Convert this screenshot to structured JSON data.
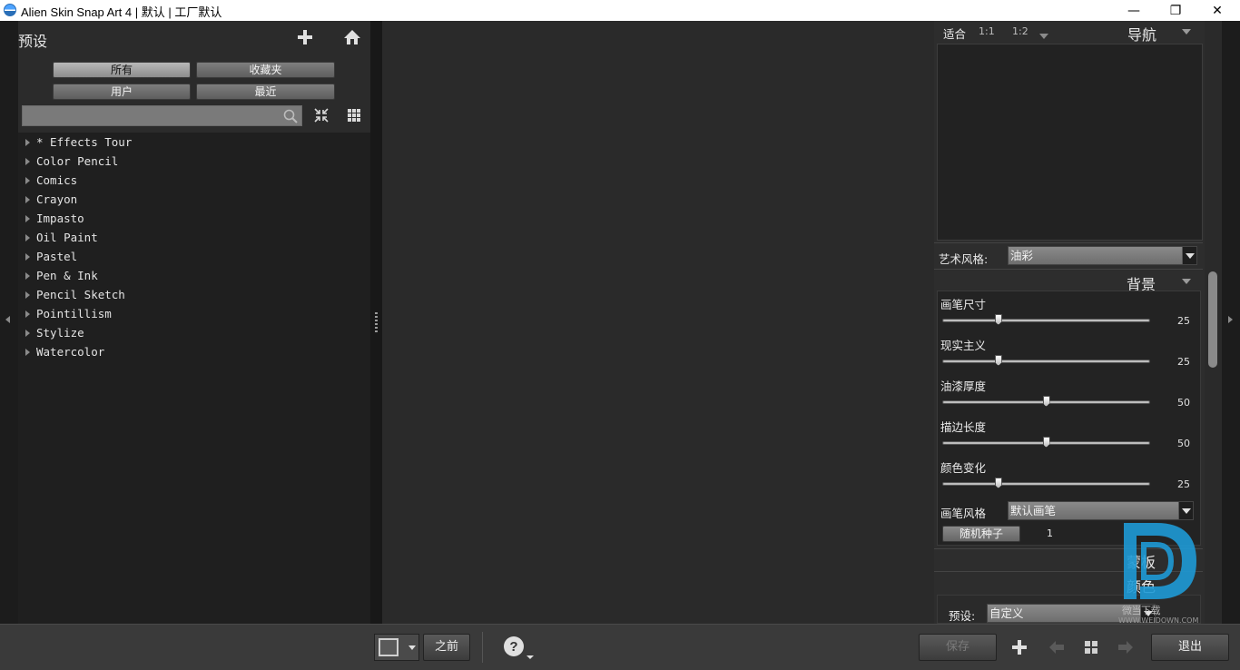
{
  "window": {
    "title": "Alien Skin Snap Art 4 | 默认 | 工厂默认",
    "minimize_glyph": "—",
    "restore_glyph": "❐",
    "close_glyph": "✕"
  },
  "presets": {
    "title": "预设",
    "filters": {
      "all": "所有",
      "favorites": "收藏夹",
      "user": "用户",
      "recent": "最近"
    },
    "search_placeholder": "",
    "items": [
      "* Effects Tour",
      "Color Pencil",
      "Comics",
      "Crayon",
      "Impasto",
      "Oil Paint",
      "Pastel",
      "Pen & Ink",
      "Pencil Sketch",
      "Pointillism",
      "Stylize",
      "Watercolor"
    ]
  },
  "navigator": {
    "fit": "适合",
    "zoom_1_1": "1:1",
    "zoom_1_2": "1:2",
    "title": "导航"
  },
  "art_style": {
    "label": "艺术风格:",
    "value": "油彩"
  },
  "background": {
    "title": "背景",
    "sliders": [
      {
        "label": "画笔尺寸",
        "value": "25",
        "fraction": 0.27
      },
      {
        "label": "现实主义",
        "value": "25",
        "fraction": 0.27
      },
      {
        "label": "油漆厚度",
        "value": "50",
        "fraction": 0.5
      },
      {
        "label": "描边长度",
        "value": "50",
        "fraction": 0.5
      },
      {
        "label": "颜色变化",
        "value": "25",
        "fraction": 0.27
      }
    ],
    "brush_style_label": "画笔风格",
    "brush_style_value": "默认画笔",
    "random_seed_label": "随机种子",
    "random_seed_value": "1"
  },
  "sections": {
    "mask": "蒙板",
    "color": "颜色"
  },
  "color_preset": {
    "label": "预设:",
    "value": "自定义"
  },
  "toolbar": {
    "before_label": "之前",
    "save_label": "保存",
    "exit_label": "退出"
  },
  "watermark": {
    "text": "WWW.WEIDOWN.COM",
    "brand": "微当下载"
  }
}
